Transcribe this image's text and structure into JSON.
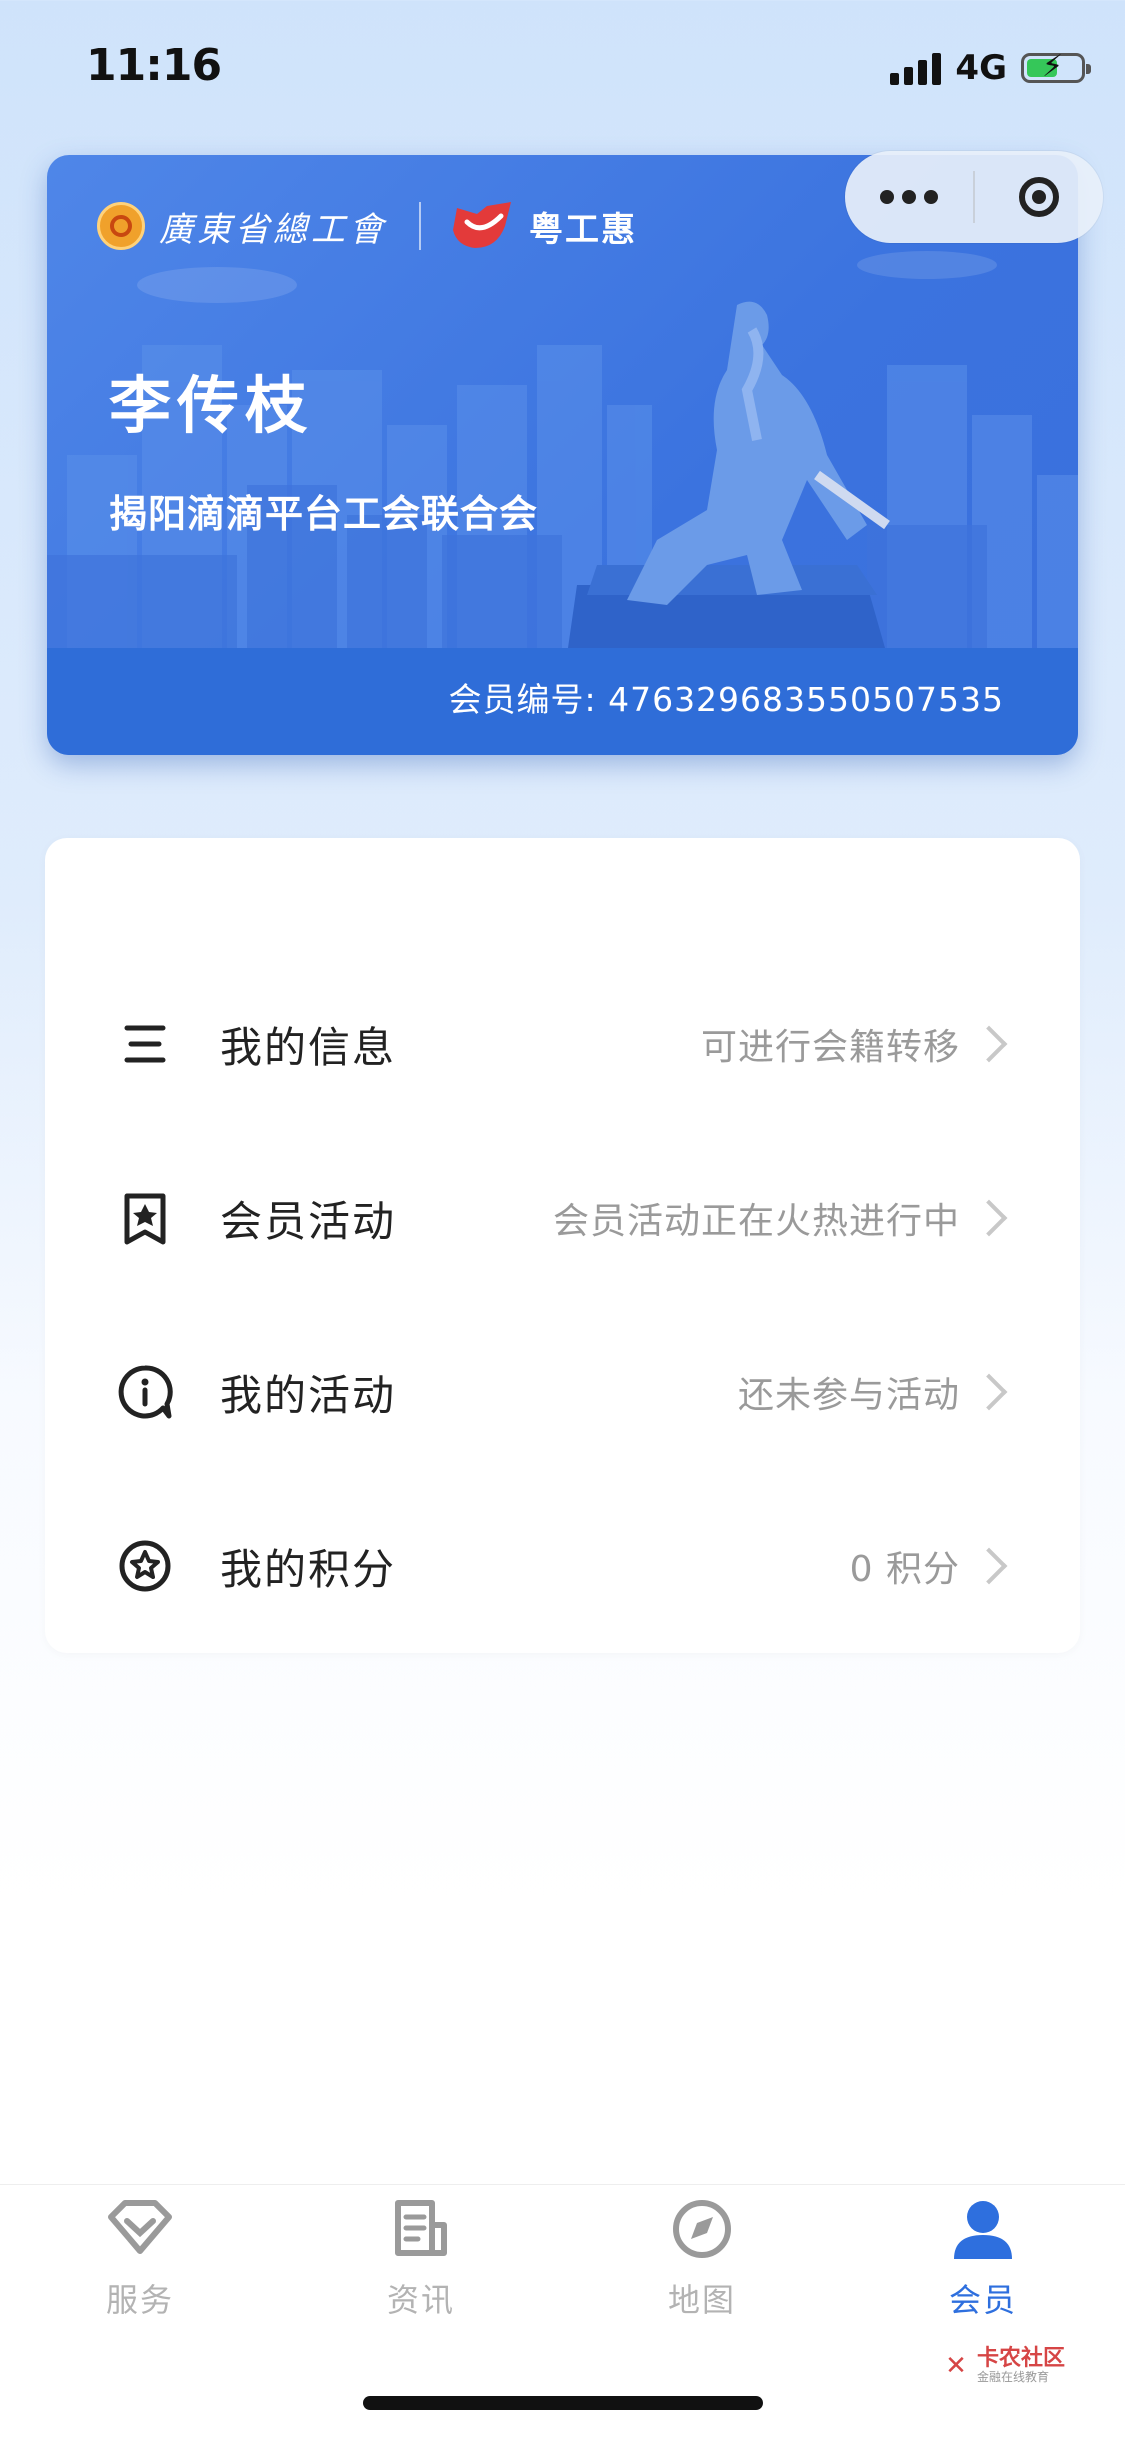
{
  "status": {
    "time": "11:16",
    "network": "4G"
  },
  "card": {
    "federation_name": "廣東省總工會",
    "brand_name": "粤工惠",
    "member_name": "李传枝",
    "organization": "揭阳滴滴平台工会联合会",
    "member_no_label": "会员编号:",
    "member_no": "476329683550507535"
  },
  "menu": [
    {
      "title": "我的信息",
      "hint": "可进行会籍转移",
      "icon": "list-icon"
    },
    {
      "title": "会员活动",
      "hint": "会员活动正在火热进行中",
      "icon": "bookmark-star-icon"
    },
    {
      "title": "我的活动",
      "hint": "还未参与活动",
      "icon": "info-bubble-icon"
    },
    {
      "title": "我的积分",
      "hint": "0 积分",
      "icon": "star-circle-icon"
    }
  ],
  "tabs": [
    {
      "label": "服务",
      "icon": "diamond-icon"
    },
    {
      "label": "资讯",
      "icon": "news-icon"
    },
    {
      "label": "地图",
      "icon": "compass-icon"
    },
    {
      "label": "会员",
      "icon": "person-icon",
      "active": true
    }
  ],
  "watermark": {
    "title": "卡农社区",
    "subtitle": "金融在线教育"
  },
  "colors": {
    "accent": "#2e6fde",
    "card": "#3b73df",
    "inactive_tab": "#b3b3b3"
  }
}
